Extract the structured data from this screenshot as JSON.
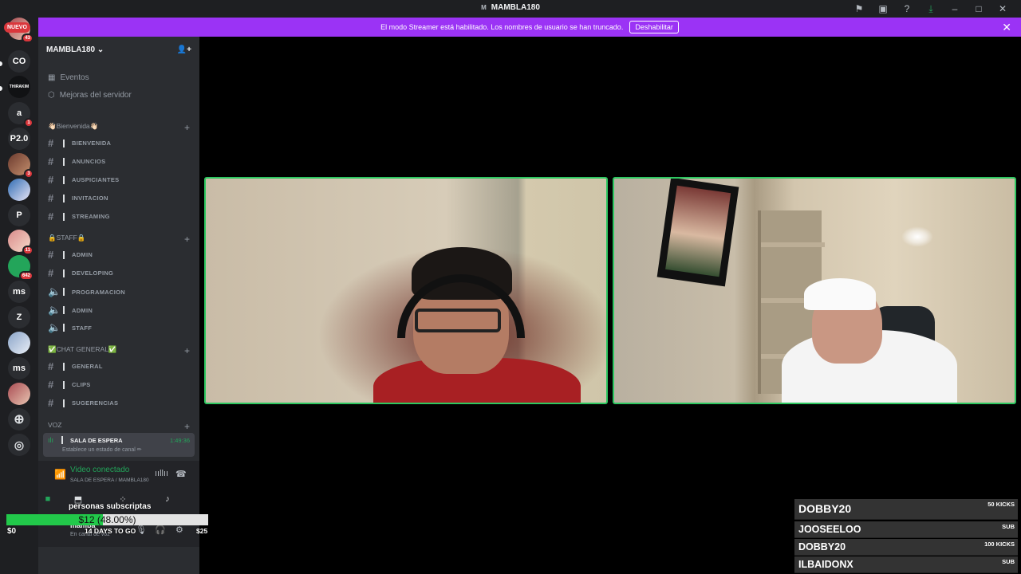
{
  "window": {
    "title_glyph": "M",
    "title": "MAMBLA180",
    "icons": [
      "inbox-icon",
      "download-icon",
      "help-icon",
      "minimize-icon",
      "maximize-icon",
      "close-icon"
    ]
  },
  "banner": {
    "text": "El modo Streamer está habilitado. Los nombres de usuario se han truncado.",
    "button": "Deshabilitar",
    "color": "#9b33f5"
  },
  "rail": {
    "nuevo": "NUEVO",
    "servers": [
      {
        "label": "",
        "badge": "43"
      },
      {
        "label": "CO",
        "badge": ""
      },
      {
        "label": "THIRAKIM",
        "badge": ""
      },
      {
        "label": "a",
        "badge": "1"
      },
      {
        "label": "P2.0",
        "badge": ""
      },
      {
        "label": "",
        "badge": "3"
      },
      {
        "label": "",
        "badge": ""
      },
      {
        "label": "P",
        "badge": ""
      },
      {
        "label": "",
        "badge": "11"
      },
      {
        "label": "",
        "badge": "642"
      },
      {
        "label": "ms",
        "badge": ""
      },
      {
        "label": "Z",
        "badge": ""
      },
      {
        "label": "",
        "badge": ""
      },
      {
        "label": "ms",
        "badge": ""
      },
      {
        "label": "",
        "badge": ""
      }
    ]
  },
  "sidebar": {
    "server_name": "MAMBLA180",
    "eventos": "Eventos",
    "mejoras": "Mejoras del servidor",
    "categories": [
      {
        "name": "👋🏻Bienvenida👋🏻",
        "channels": [
          "BIENVENIDA",
          "ANUNCIOS",
          "AUSPICIANTES",
          "INVITACION",
          "STREAMING"
        ]
      },
      {
        "name": "🔒STAFF🔒",
        "channels": [
          "ADMIN",
          "DEVELOPING",
          "PROGRAMACION",
          "ADMIN",
          "STAFF"
        ]
      },
      {
        "name": "✅CHAT GENERAL✅",
        "channels": [
          "GENERAL",
          "CLIPS",
          "SUGERENCIAS"
        ]
      },
      {
        "name": "VOZ",
        "channels": []
      }
    ],
    "voice_channel": {
      "name": "SALA DE ESPERA",
      "time": "1:49:36",
      "status": "Establece un estado de canal ✏"
    },
    "voice_panel": {
      "connected": "Video conectado",
      "location": "SALA DE ESPERA / MAMBLA180"
    },
    "user": {
      "name": "mamba",
      "status": "En canal de voz"
    }
  },
  "overlay": {
    "label": "personas subscriptas",
    "goal_text": "$12 (48.00%)",
    "goal_percent": 48,
    "low": "$0",
    "days": "14 DAYS TO GO",
    "high": "$25"
  },
  "kicks": [
    {
      "name": "DOBBY20",
      "amount": "50 KICKS"
    },
    {
      "name": "JOOSEELOO",
      "amount": "SUB"
    },
    {
      "name": "DOBBY20",
      "amount": "100 KICKS"
    },
    {
      "name": "ILBAIDONX",
      "amount": "SUB"
    }
  ],
  "colors": {
    "accent_green": "#23a55a",
    "tile_border": "#2dc760",
    "danger": "#da373c"
  }
}
